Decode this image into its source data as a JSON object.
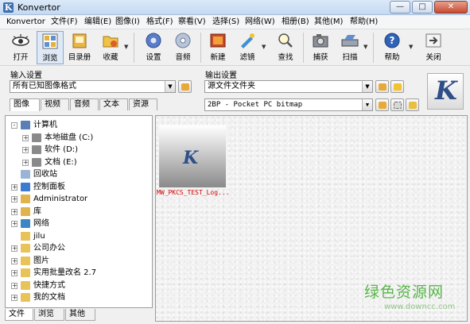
{
  "window": {
    "title": "Konvertor",
    "buttons": [
      "—",
      "□",
      "✕"
    ]
  },
  "menu": [
    "Konvertor",
    "文件(F)",
    "编辑(E)",
    "图像(I)",
    "格式(F)",
    "察看(V)",
    "选择(S)",
    "网络(W)",
    "相册(B)",
    "其他(M)",
    "帮助(H)"
  ],
  "toolbar": {
    "open": "打开",
    "browse": "浏览",
    "catalog": "目录册",
    "favorites": "收藏",
    "settings": "设置",
    "audio": "音频",
    "new": "新建",
    "filter": "滤镜",
    "find": "查找",
    "capture": "捕获",
    "scan": "扫描",
    "help": "帮助",
    "close": "关闭"
  },
  "input_settings": {
    "label": "输入设置",
    "format": "所有已知图像格式",
    "tabs": [
      "图像",
      "视频",
      "音频",
      "文本",
      "资源"
    ]
  },
  "output_settings": {
    "label": "输出设置",
    "folder": "源文件文件夹",
    "format": "2BP - Pocket PC bitmap"
  },
  "logo_letter": "K",
  "tree": [
    {
      "label": "计算机",
      "indent": 0,
      "exp": "-",
      "icon": "computer-icon",
      "color": "#5a7fb5"
    },
    {
      "label": "本地磁盘 (C:)",
      "indent": 1,
      "exp": "+",
      "icon": "drive-icon",
      "color": "#8a8a8a"
    },
    {
      "label": "软件 (D:)",
      "indent": 1,
      "exp": "+",
      "icon": "drive-icon",
      "color": "#8a8a8a"
    },
    {
      "label": "文档 (E:)",
      "indent": 1,
      "exp": "+",
      "icon": "drive-icon",
      "color": "#8a8a8a"
    },
    {
      "label": "回收站",
      "indent": 0,
      "exp": "",
      "icon": "recycle-bin-icon",
      "color": "#9ab4d6"
    },
    {
      "label": "控制面板",
      "indent": 0,
      "exp": "+",
      "icon": "control-panel-icon",
      "color": "#3d7bd0"
    },
    {
      "label": "Administrator",
      "indent": 0,
      "exp": "+",
      "icon": "user-folder-icon",
      "color": "#e0b34c"
    },
    {
      "label": "库",
      "indent": 0,
      "exp": "+",
      "icon": "library-icon",
      "color": "#e0b34c"
    },
    {
      "label": "网络",
      "indent": 0,
      "exp": "+",
      "icon": "network-icon",
      "color": "#3d86c6"
    },
    {
      "label": "jilu",
      "indent": 0,
      "exp": "",
      "icon": "folder-icon",
      "color": "#e8c35a"
    },
    {
      "label": "公司办公",
      "indent": 0,
      "exp": "+",
      "icon": "folder-icon",
      "color": "#e8c35a"
    },
    {
      "label": "图片",
      "indent": 0,
      "exp": "+",
      "icon": "folder-icon",
      "color": "#e8c35a"
    },
    {
      "label": "实用批量改名 2.7",
      "indent": 0,
      "exp": "+",
      "icon": "folder-icon",
      "color": "#e8c35a"
    },
    {
      "label": "快捷方式",
      "indent": 0,
      "exp": "+",
      "icon": "folder-icon",
      "color": "#e8c35a"
    },
    {
      "label": "我的文档",
      "indent": 0,
      "exp": "+",
      "icon": "folder-icon",
      "color": "#e8c35a"
    }
  ],
  "bottom_tabs": [
    "文件",
    "浏览",
    "其他"
  ],
  "browser": {
    "thumb_letter": "K",
    "thumb_caption": "MW_PKCS_TEST_Log..."
  },
  "watermark": {
    "main": "绿色资源网",
    "url": "www.downcc.com"
  }
}
